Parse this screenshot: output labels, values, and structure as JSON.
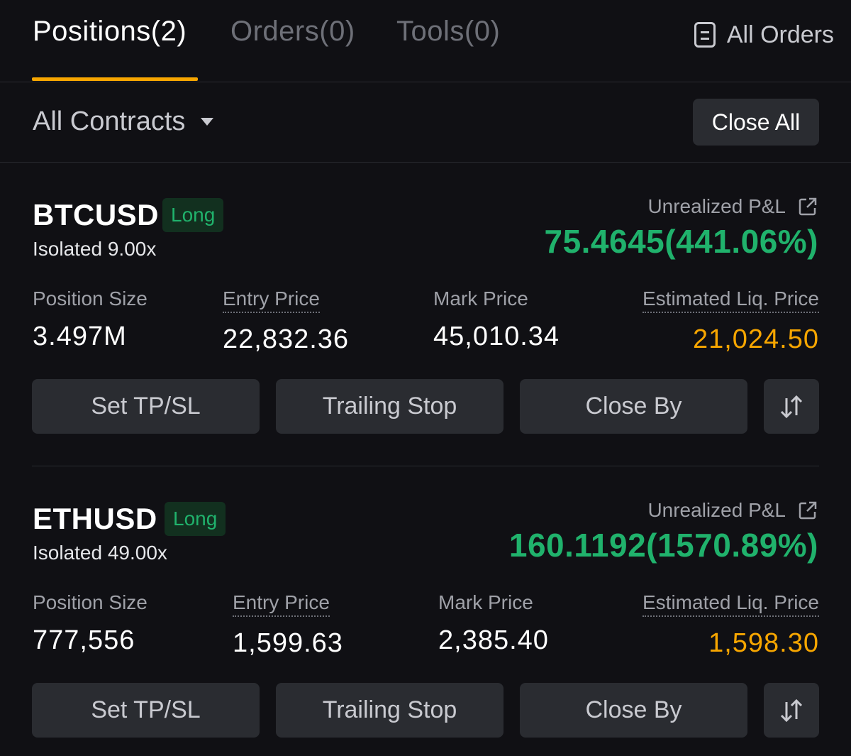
{
  "tabs": [
    {
      "label": "Positions(2)",
      "active": true
    },
    {
      "label": "Orders(0)",
      "active": false
    },
    {
      "label": "Tools(0)",
      "active": false
    }
  ],
  "header": {
    "all_orders_label": "All Orders",
    "all_orders_icon": "document-list-icon"
  },
  "filter": {
    "contracts_label": "All Contracts",
    "caret_icon": "caret-down-icon",
    "close_all_label": "Close All"
  },
  "colors": {
    "accent": "#f7a600",
    "profit": "#20b26c",
    "liq_price": "#f7a600",
    "background": "#101014"
  },
  "positions": [
    {
      "symbol": "BTCUSD",
      "side": "Long",
      "margin_mode": "Isolated 9.00x",
      "pnl_label": "Unrealized P&L",
      "pnl_value": "75.4645(441.06%)",
      "size_label": "Position Size",
      "size_value": "3.497M",
      "entry_label": "Entry Price",
      "entry_value": "22,832.36",
      "mark_label": "Mark Price",
      "mark_value": "45,010.34",
      "liq_label": "Estimated Liq. Price",
      "liq_value": "21,024.50",
      "buttons": {
        "tpsl": "Set TP/SL",
        "trailing": "Trailing Stop",
        "close_by": "Close By"
      }
    },
    {
      "symbol": "ETHUSD",
      "side": "Long",
      "margin_mode": "Isolated 49.00x",
      "pnl_label": "Unrealized P&L",
      "pnl_value": "160.1192(1570.89%)",
      "size_label": "Position Size",
      "size_value": "777,556",
      "entry_label": "Entry Price",
      "entry_value": "1,599.63",
      "mark_label": "Mark Price",
      "mark_value": "2,385.40",
      "liq_label": "Estimated Liq. Price",
      "liq_value": "1,598.30",
      "buttons": {
        "tpsl": "Set TP/SL",
        "trailing": "Trailing Stop",
        "close_by": "Close By"
      }
    }
  ]
}
